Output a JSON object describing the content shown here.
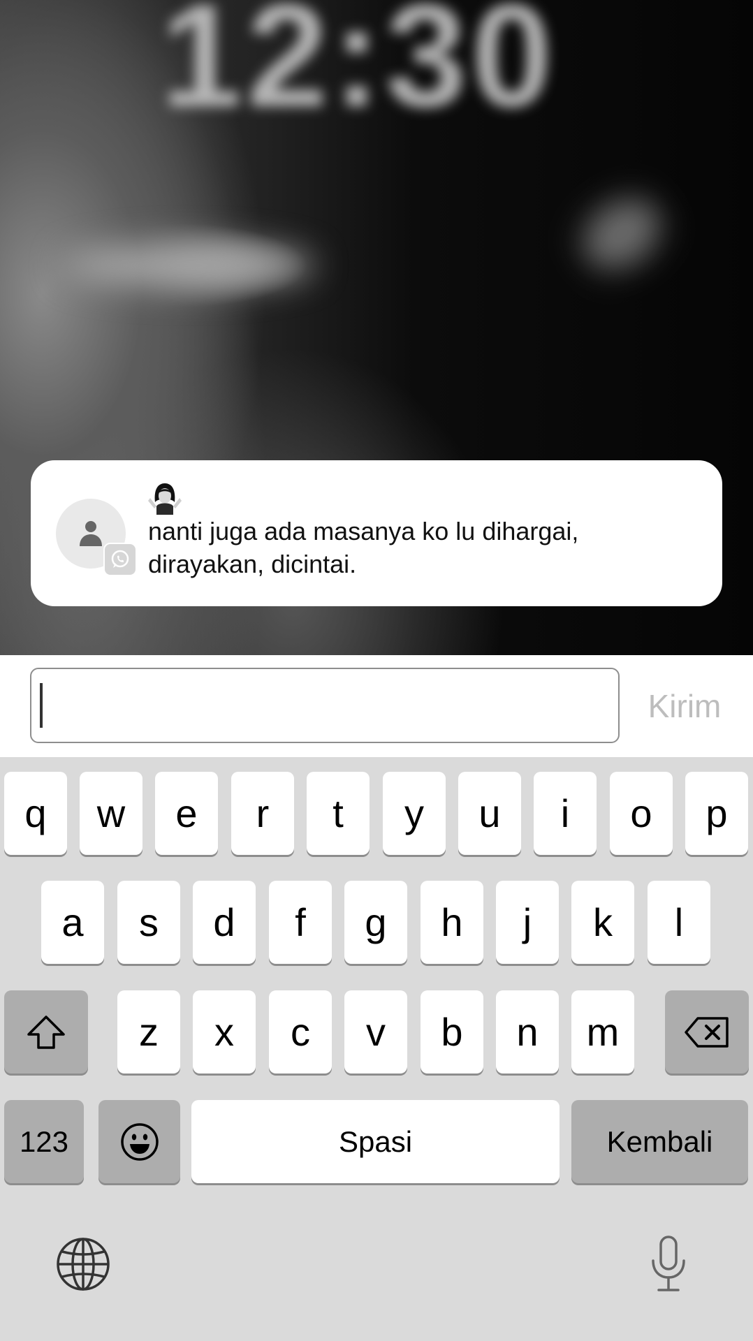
{
  "background": {
    "clock_text": "12:30"
  },
  "notification": {
    "emoji": "🤷‍♀️",
    "message": "nanti juga ada masanya ko lu dihargai, dirayakan, dicintai.",
    "app_badge_icon": "whatsapp-icon",
    "avatar_icon": "person-icon"
  },
  "reply": {
    "input_value": "",
    "send_label": "Kirim"
  },
  "keyboard": {
    "row1": [
      "q",
      "w",
      "e",
      "r",
      "t",
      "y",
      "u",
      "i",
      "o",
      "p"
    ],
    "row2": [
      "a",
      "s",
      "d",
      "f",
      "g",
      "h",
      "j",
      "k",
      "l"
    ],
    "row3": [
      "z",
      "x",
      "c",
      "v",
      "b",
      "n",
      "m"
    ],
    "numbers_label": "123",
    "space_label": "Spasi",
    "return_label": "Kembali",
    "shift_icon": "shift-icon",
    "delete_icon": "backspace-icon",
    "emoji_icon": "emoji-icon",
    "globe_icon": "globe-icon",
    "mic_icon": "microphone-icon"
  }
}
